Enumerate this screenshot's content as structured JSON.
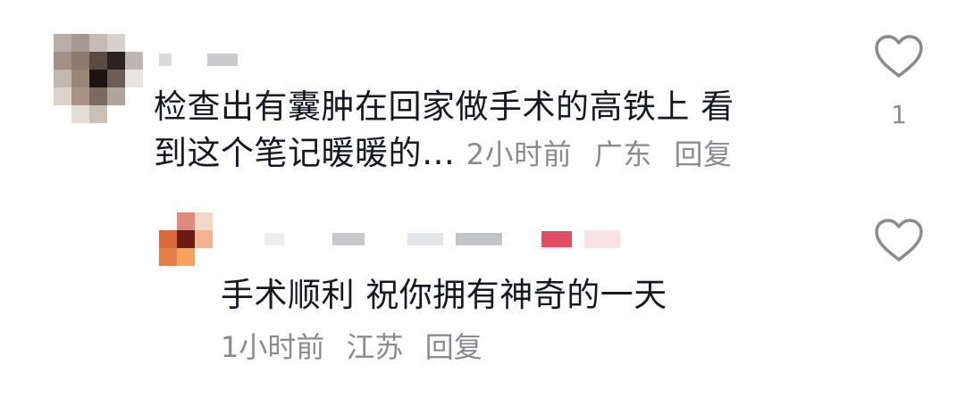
{
  "comments": [
    {
      "text": "检查出有囊肿在回家做手术的高铁上 看到这个笔记暖暖的…",
      "text_line1": "检查出有囊肿在回家做手术的高铁上 看",
      "text_line2": "到这个笔记暖暖的…",
      "time": "2小时前",
      "location": "广东",
      "reply_label": "回复",
      "like_count": "1",
      "like_icon": "heart-outline-icon"
    },
    {
      "text": "手术顺利 祝你拥有神奇的一天",
      "time": "1小时前",
      "location": "江苏",
      "reply_label": "回复",
      "like_count": "",
      "like_icon": "heart-outline-icon"
    }
  ],
  "colors": {
    "text": "#161823",
    "meta": "#8a8b91",
    "icon": "#8a8b91",
    "background": "#ffffff"
  }
}
